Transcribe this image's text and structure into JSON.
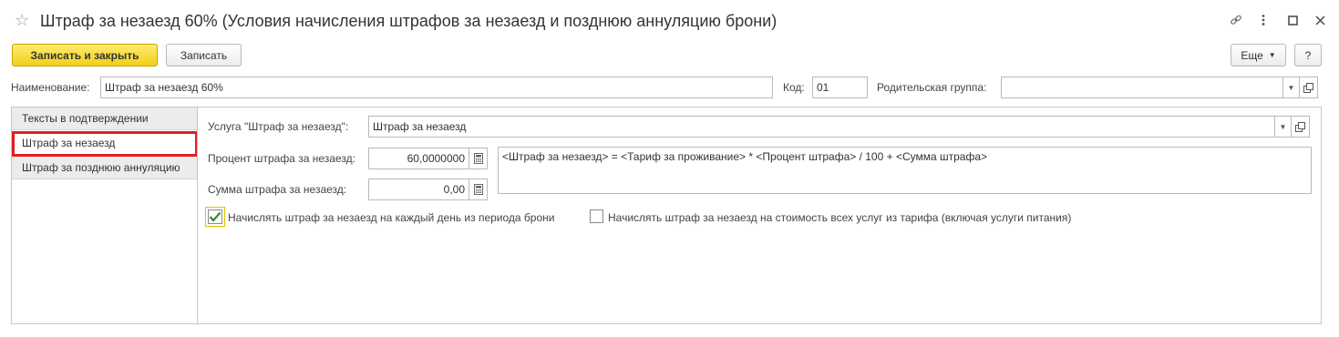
{
  "window": {
    "title": "Штраф за незаезд 60% (Условия начисления штрафов за незаезд и позднюю аннуляцию брони)",
    "favorite_icon": "star-icon",
    "controls": [
      "link-icon",
      "more-icon",
      "maximize-icon",
      "close-icon"
    ]
  },
  "toolbar": {
    "save_close_label": "Записать и закрыть",
    "save_label": "Записать",
    "more_label": "Еще",
    "help_label": "?"
  },
  "header": {
    "name_label": "Наименование:",
    "name_value": "Штраф за незаезд 60%",
    "code_label": "Код:",
    "code_value": "01",
    "parent_label": "Родительская группа:",
    "parent_value": ""
  },
  "tabs": [
    {
      "label": "Тексты в подтверждении"
    },
    {
      "label": "Штраф за незаезд"
    },
    {
      "label": "Штраф за позднюю аннуляцию"
    }
  ],
  "form": {
    "service_label": "Услуга \"Штраф за незаезд\":",
    "service_value": "Штраф за незаезд",
    "percent_label": "Процент штрафа за незаезд:",
    "percent_value": "60,0000000",
    "amount_label": "Сумма штрафа за незаезд:",
    "amount_value": "0,00",
    "formula_text": "<Штраф за незаезд> = <Тариф за проживание> * <Процент штрафа> / 100 + <Сумма штрафа>",
    "checkbox_each_day_label": "Начислять штраф за незаезд на каждый день из периода брони",
    "checkbox_each_day_checked": true,
    "checkbox_all_services_label": "Начислять штраф за незаезд на стоимость всех услуг из тарифа (включая услуги питания)",
    "checkbox_all_services_checked": false
  },
  "colors": {
    "primary_button": "#f2cf1a",
    "highlight": "#e01f25",
    "check_mark": "#2e8b2e"
  }
}
